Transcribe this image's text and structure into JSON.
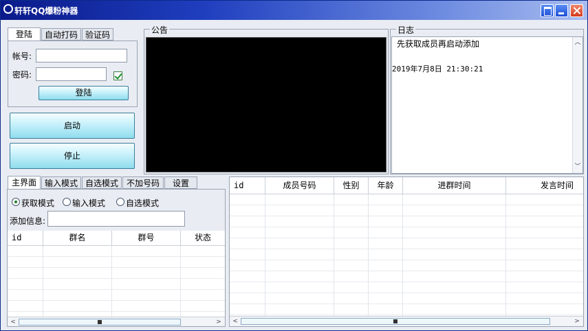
{
  "window": {
    "title": "轩轩QQ爆粉神器"
  },
  "login_tabs": [
    "登陆",
    "自动打码",
    "验证码"
  ],
  "login": {
    "account_label": "帐号:",
    "account_value": "",
    "password_label": "密码:",
    "password_value": "",
    "login_button": "登陆"
  },
  "actions": {
    "start": "启动",
    "stop": "停止"
  },
  "notice": {
    "title": "公告"
  },
  "log": {
    "title": "日志",
    "lines": [
      "先获取成员再启动添加",
      "2019年7月8日 21:30:21"
    ]
  },
  "mode_tabs": [
    "主界面",
    "输入模式",
    "自选模式",
    "不加号码",
    "设置"
  ],
  "modes": {
    "options": [
      "获取模式",
      "输入模式",
      "自选模式"
    ],
    "selected": "获取模式",
    "add_info_label": "添加信息:",
    "add_info_value": ""
  },
  "group_table": {
    "columns": [
      "id",
      "群名",
      "群号",
      "状态"
    ],
    "rows": []
  },
  "member_table": {
    "columns": [
      "id",
      "成员号码",
      "性别",
      "年龄",
      "进群时间",
      "发言时间"
    ],
    "rows": []
  },
  "colors": {
    "titlebar_start": "#0a1a8a",
    "titlebar_end": "#a9bdf0",
    "button_accent": "#8fdcec",
    "notice_bg": "#000000"
  }
}
